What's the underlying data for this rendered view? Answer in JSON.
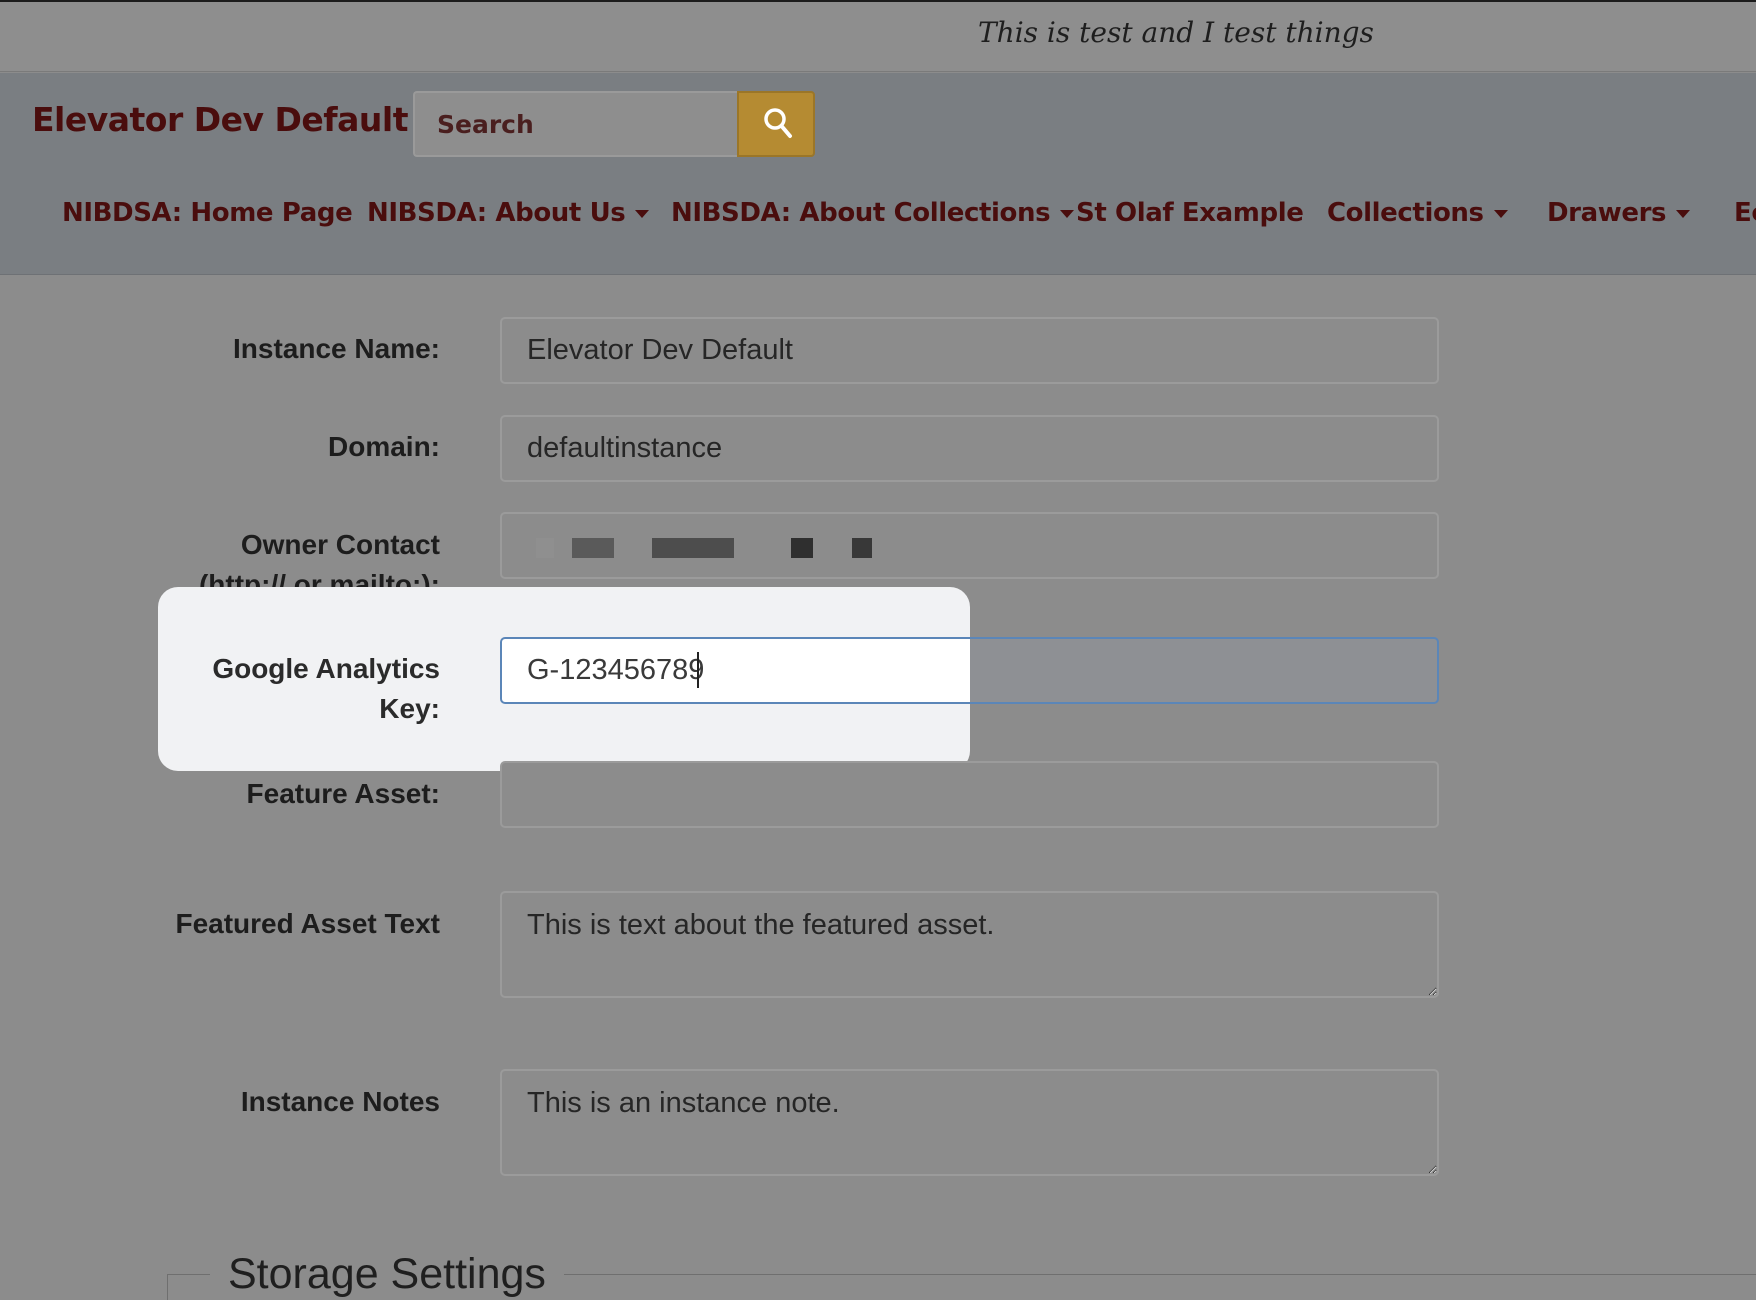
{
  "banner": {
    "tagline": "This is test and I test things"
  },
  "header": {
    "brand": "Elevator Dev Default",
    "search": {
      "placeholder": "Search",
      "icon": "search-icon"
    }
  },
  "nav": {
    "items": [
      {
        "label": "NIBDSA: Home Page",
        "dropdown": false
      },
      {
        "label": "NIBSDA: About Us",
        "dropdown": true
      },
      {
        "label": "NIBSDA: About Collections",
        "dropdown": true
      },
      {
        "label": "St Olaf Example",
        "dropdown": false
      },
      {
        "label": "Collections",
        "dropdown": true
      },
      {
        "label": "Drawers",
        "dropdown": true
      },
      {
        "label": "Ec",
        "dropdown": false
      }
    ]
  },
  "form": {
    "instance_name": {
      "label": "Instance Name:",
      "value": "Elevator Dev Default"
    },
    "domain": {
      "label": "Domain:",
      "value": "defaultinstance"
    },
    "owner_contact": {
      "label_line1": "Owner Contact",
      "label_line2": "(http:// or mailto:):"
    },
    "google_analytics": {
      "label_line1": "Google Analytics",
      "label_line2": "Key:",
      "value": "G-123456789"
    },
    "feature_asset": {
      "label": "Feature Asset:",
      "value": ""
    },
    "featured_asset_text": {
      "label": "Featured Asset Text",
      "value": "This is text about the featured asset."
    },
    "instance_notes": {
      "label": "Instance Notes",
      "value": "This is an instance note."
    }
  },
  "storage": {
    "legend": "Storage Settings"
  },
  "colors": {
    "brand": "#4a0d0d",
    "search_button": "#b58b32",
    "focus_border": "#5b86b8",
    "spotlight": "#f1f2f4"
  }
}
